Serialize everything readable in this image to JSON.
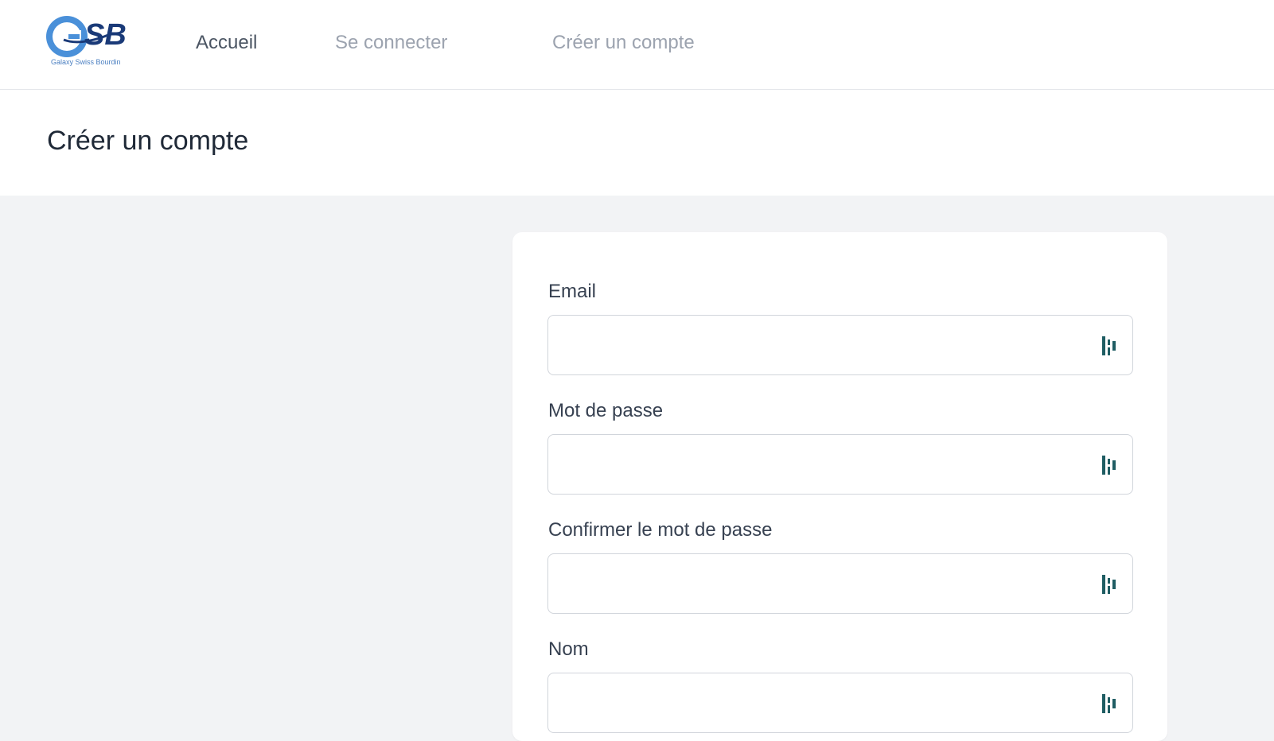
{
  "logo": {
    "mark_text": "GSB",
    "caption": "Galaxy Swiss Bourdin"
  },
  "nav": {
    "home": "Accueil",
    "login": "Se connecter",
    "register": "Créer un compte"
  },
  "page": {
    "title": "Créer un compte"
  },
  "form": {
    "fields": [
      {
        "label": "Email",
        "value": "",
        "placeholder": ""
      },
      {
        "label": "Mot de passe",
        "value": "",
        "placeholder": ""
      },
      {
        "label": "Confirmer le mot de passe",
        "value": "",
        "placeholder": ""
      },
      {
        "label": "Nom",
        "value": "",
        "placeholder": ""
      }
    ],
    "field_icon": "password-manager-icon"
  },
  "colors": {
    "logo_light_blue": "#4a90d9",
    "logo_dark_blue": "#1a3a78",
    "field_icon": "#1f5d63"
  }
}
